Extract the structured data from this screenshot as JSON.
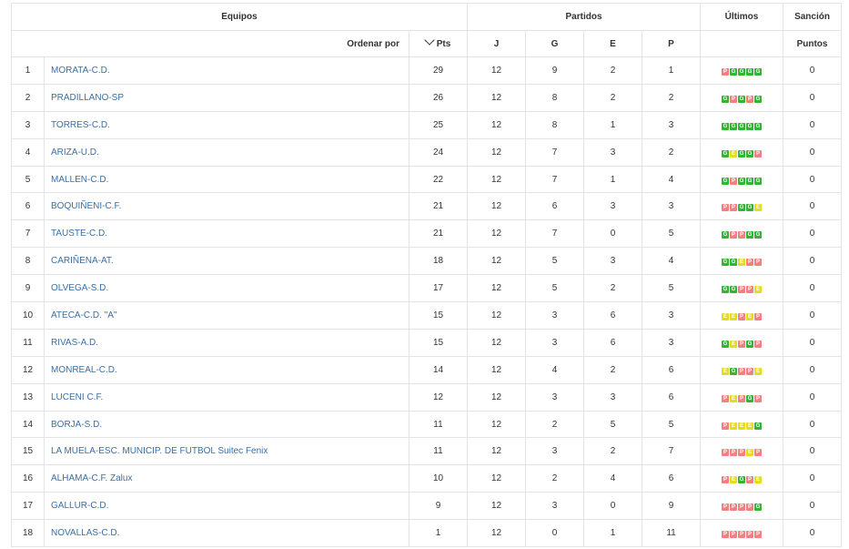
{
  "header": {
    "equipos": "Equipos",
    "partidos": "Partidos",
    "ultimos": "Últimos",
    "sancion": "Sanción",
    "ordenar_por": "Ordenar por",
    "pts": "Pts",
    "j": "J",
    "g": "G",
    "e": "E",
    "p": "P",
    "puntos": "Puntos"
  },
  "colors": {
    "win": "#33b533",
    "loss": "#f38080",
    "draw": "#e3dd1e",
    "team_link": "#3a6fa5"
  },
  "rows": [
    {
      "pos": "1",
      "team": "MORATA-C.D.",
      "pts": "29",
      "j": "12",
      "g": "9",
      "e": "2",
      "p": "1",
      "form": [
        "P",
        "G",
        "G",
        "G",
        "G"
      ],
      "sancion": "0"
    },
    {
      "pos": "2",
      "team": "PRADILLANO-SP",
      "pts": "26",
      "j": "12",
      "g": "8",
      "e": "2",
      "p": "2",
      "form": [
        "G",
        "P",
        "G",
        "P",
        "G"
      ],
      "sancion": "0"
    },
    {
      "pos": "3",
      "team": "TORRES-C.D.",
      "pts": "25",
      "j": "12",
      "g": "8",
      "e": "1",
      "p": "3",
      "form": [
        "G",
        "G",
        "G",
        "G",
        "G"
      ],
      "sancion": "0"
    },
    {
      "pos": "4",
      "team": "ARIZA-U.D.",
      "pts": "24",
      "j": "12",
      "g": "7",
      "e": "3",
      "p": "2",
      "form": [
        "G",
        "E",
        "G",
        "G",
        "P"
      ],
      "sancion": "0"
    },
    {
      "pos": "5",
      "team": "MALLEN-C.D.",
      "pts": "22",
      "j": "12",
      "g": "7",
      "e": "1",
      "p": "4",
      "form": [
        "G",
        "P",
        "G",
        "G",
        "G"
      ],
      "sancion": "0"
    },
    {
      "pos": "6",
      "team": "BOQUIÑENI-C.F.",
      "pts": "21",
      "j": "12",
      "g": "6",
      "e": "3",
      "p": "3",
      "form": [
        "P",
        "P",
        "G",
        "G",
        "E"
      ],
      "sancion": "0"
    },
    {
      "pos": "7",
      "team": "TAUSTE-C.D.",
      "pts": "21",
      "j": "12",
      "g": "7",
      "e": "0",
      "p": "5",
      "form": [
        "G",
        "P",
        "P",
        "G",
        "G"
      ],
      "sancion": "0"
    },
    {
      "pos": "8",
      "team": "CARIÑENA-AT.",
      "pts": "18",
      "j": "12",
      "g": "5",
      "e": "3",
      "p": "4",
      "form": [
        "G",
        "G",
        "E",
        "P",
        "P"
      ],
      "sancion": "0"
    },
    {
      "pos": "9",
      "team": "OLVEGA-S.D.",
      "pts": "17",
      "j": "12",
      "g": "5",
      "e": "2",
      "p": "5",
      "form": [
        "G",
        "G",
        "P",
        "P",
        "E"
      ],
      "sancion": "0"
    },
    {
      "pos": "10",
      "team": "ATECA-C.D. \"A\"",
      "pts": "15",
      "j": "12",
      "g": "3",
      "e": "6",
      "p": "3",
      "form": [
        "E",
        "E",
        "P",
        "E",
        "P"
      ],
      "sancion": "0"
    },
    {
      "pos": "11",
      "team": "RIVAS-A.D.",
      "pts": "15",
      "j": "12",
      "g": "3",
      "e": "6",
      "p": "3",
      "form": [
        "G",
        "E",
        "P",
        "G",
        "P"
      ],
      "sancion": "0"
    },
    {
      "pos": "12",
      "team": "MONREAL-C.D.",
      "pts": "14",
      "j": "12",
      "g": "4",
      "e": "2",
      "p": "6",
      "form": [
        "E",
        "G",
        "P",
        "P",
        "E"
      ],
      "sancion": "0"
    },
    {
      "pos": "13",
      "team": "LUCENI C.F.",
      "pts": "12",
      "j": "12",
      "g": "3",
      "e": "3",
      "p": "6",
      "form": [
        "P",
        "E",
        "P",
        "G",
        "P"
      ],
      "sancion": "0"
    },
    {
      "pos": "14",
      "team": "BORJA-S.D.",
      "pts": "11",
      "j": "12",
      "g": "2",
      "e": "5",
      "p": "5",
      "form": [
        "P",
        "E",
        "E",
        "E",
        "G"
      ],
      "sancion": "0"
    },
    {
      "pos": "15",
      "team": "LA MUELA-ESC. MUNICIP. DE FUTBOL Suitec Fenix",
      "pts": "11",
      "j": "12",
      "g": "3",
      "e": "2",
      "p": "7",
      "form": [
        "P",
        "P",
        "P",
        "E",
        "P"
      ],
      "sancion": "0"
    },
    {
      "pos": "16",
      "team": "ALHAMA-C.F. Zalux",
      "pts": "10",
      "j": "12",
      "g": "2",
      "e": "4",
      "p": "6",
      "form": [
        "P",
        "E",
        "G",
        "P",
        "E"
      ],
      "sancion": "0"
    },
    {
      "pos": "17",
      "team": "GALLUR-C.D.",
      "pts": "9",
      "j": "12",
      "g": "3",
      "e": "0",
      "p": "9",
      "form": [
        "P",
        "P",
        "P",
        "P",
        "G"
      ],
      "sancion": "0"
    },
    {
      "pos": "18",
      "team": "NOVALLAS-C.D.",
      "pts": "1",
      "j": "12",
      "g": "0",
      "e": "1",
      "p": "11",
      "form": [
        "P",
        "P",
        "P",
        "P",
        "P"
      ],
      "sancion": "0"
    }
  ]
}
